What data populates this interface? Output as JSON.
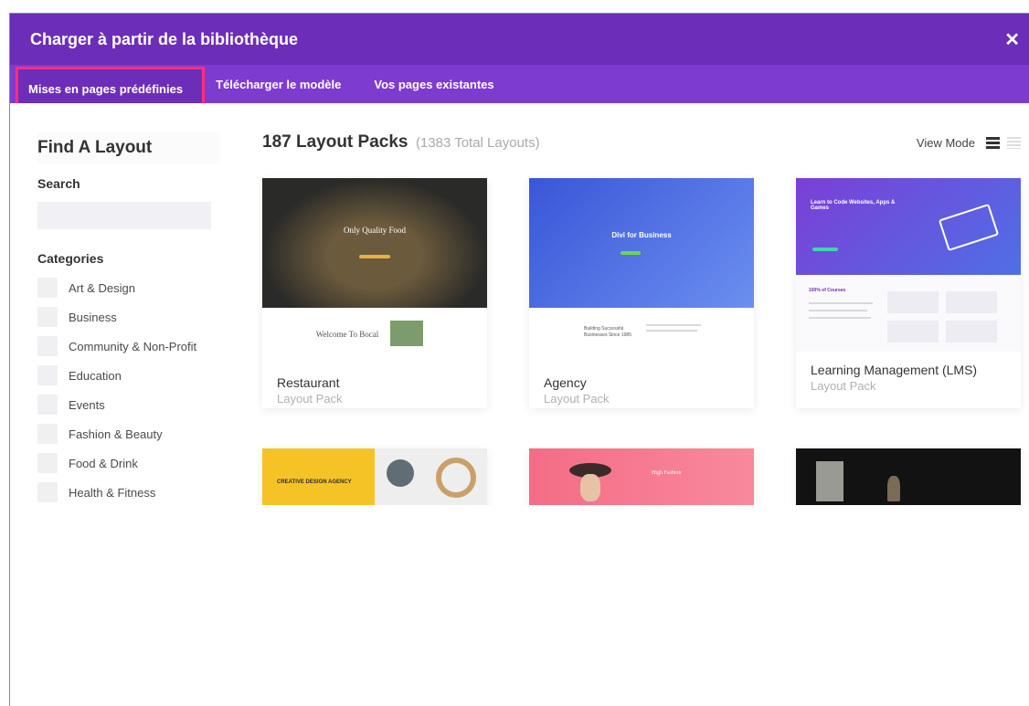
{
  "dialog": {
    "title": "Charger à partir de la bibliothèque",
    "close_icon": "close-icon"
  },
  "tabs": [
    {
      "label": "Mises en pages prédéfinies",
      "active": true
    },
    {
      "label": "Télécharger le modèle",
      "active": false
    },
    {
      "label": "Vos pages existantes",
      "active": false
    }
  ],
  "sidebar": {
    "heading": "Find A Layout",
    "search_label": "Search",
    "search_value": "",
    "categories_label": "Categories",
    "categories": [
      "Art & Design",
      "Business",
      "Community & Non-Profit",
      "Education",
      "Events",
      "Fashion & Beauty",
      "Food & Drink",
      "Health & Fitness"
    ]
  },
  "main": {
    "title": "187 Layout Packs",
    "total": "(1383 Total Layouts)",
    "view_mode_label": "View Mode",
    "view_modes": [
      "grid-view-icon",
      "list-view-icon"
    ],
    "cards": [
      {
        "title": "Restaurant",
        "subtitle": "Layout Pack",
        "thumb_text": "Only Quality Food",
        "thumb_sub": "Welcome To Bocal"
      },
      {
        "title": "Agency",
        "subtitle": "Layout Pack",
        "thumb_text": "Divi for Business",
        "thumb_sub": "Building Successful Businesses Since 1985"
      },
      {
        "title": "Learning Management (LMS)",
        "subtitle": "Layout Pack",
        "thumb_text": "Learn to Code Websites, Apps & Games",
        "thumb_sub": "100% of Courses"
      },
      {
        "title": "",
        "subtitle": "",
        "thumb_text": "CREATIVE DESIGN AGENCY"
      },
      {
        "title": "",
        "subtitle": "",
        "thumb_text": "High Fashion"
      },
      {
        "title": "",
        "subtitle": "",
        "thumb_text": ""
      }
    ]
  },
  "colors": {
    "header_purple": "#6c2eb9",
    "tab_purple": "#7e3bd0",
    "active_outline": "#ff2e7a"
  }
}
